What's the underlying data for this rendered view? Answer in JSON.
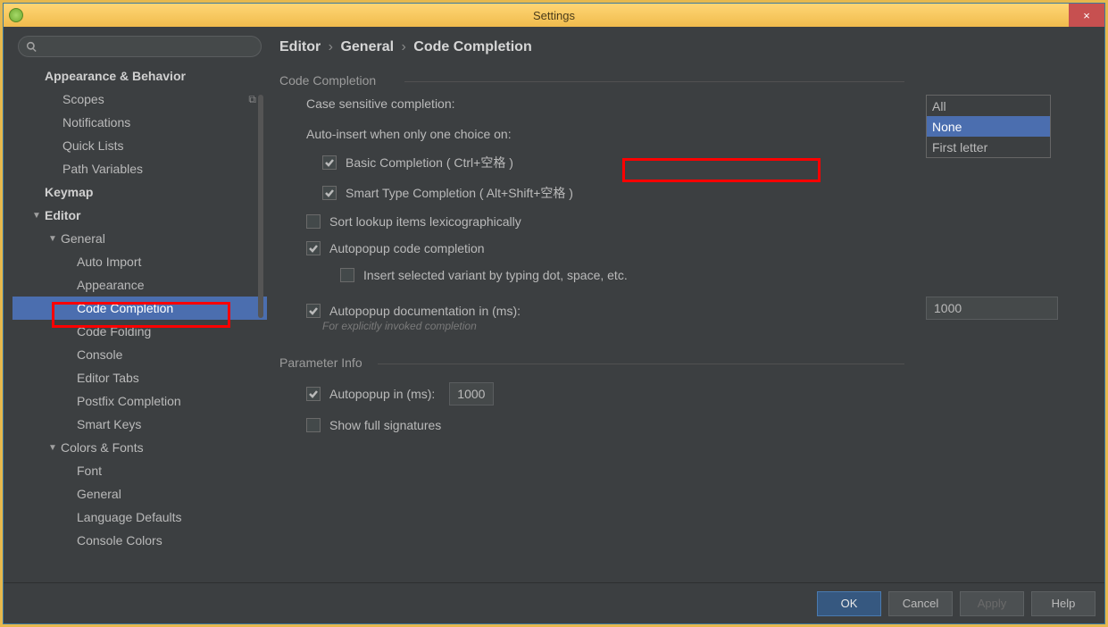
{
  "titlebar": {
    "title": "Settings",
    "close": "×"
  },
  "tree": {
    "items": [
      {
        "label": "Appearance & Behavior",
        "cat": true,
        "pad": "pad0"
      },
      {
        "label": "Scopes",
        "pad": "pad1",
        "copy": true
      },
      {
        "label": "Notifications",
        "pad": "pad1"
      },
      {
        "label": "Quick Lists",
        "pad": "pad1"
      },
      {
        "label": "Path Variables",
        "pad": "pad1"
      },
      {
        "label": "Keymap",
        "cat": true,
        "pad": "pad0"
      },
      {
        "label": "Editor",
        "cat": true,
        "arrow": "▼",
        "pad": "arrow-pad0"
      },
      {
        "label": "General",
        "arrow": "▼",
        "pad": "arrow-pad1"
      },
      {
        "label": "Auto Import",
        "pad": "pad2"
      },
      {
        "label": "Appearance",
        "pad": "pad2"
      },
      {
        "label": "Code Completion",
        "pad": "pad2",
        "sel": true
      },
      {
        "label": "Code Folding",
        "pad": "pad2"
      },
      {
        "label": "Console",
        "pad": "pad2"
      },
      {
        "label": "Editor Tabs",
        "pad": "pad2"
      },
      {
        "label": "Postfix Completion",
        "pad": "pad2"
      },
      {
        "label": "Smart Keys",
        "pad": "pad2"
      },
      {
        "label": "Colors & Fonts",
        "arrow": "▼",
        "pad": "arrow-pad1"
      },
      {
        "label": "Font",
        "pad": "pad2"
      },
      {
        "label": "General",
        "pad": "pad2"
      },
      {
        "label": "Language Defaults",
        "pad": "pad2"
      },
      {
        "label": "Console Colors",
        "pad": "pad2"
      }
    ]
  },
  "breadcrumb": {
    "a": "Editor",
    "b": "General",
    "c": "Code Completion",
    "sep": "›"
  },
  "sections": {
    "code_completion": "Code Completion",
    "parameter_info": "Parameter Info"
  },
  "form": {
    "case_label": "Case sensitive completion:",
    "case_value": "None",
    "auto_insert_label": "Auto-insert when only one choice on:",
    "basic": "Basic Completion ( Ctrl+空格 )",
    "smart": "Smart Type Completion ( Alt+Shift+空格 )",
    "sort": "Sort lookup items lexicographically",
    "autopopup_cc": "Autopopup code completion",
    "insert_variant": "Insert selected variant by typing dot, space, etc.",
    "autopopup_doc": "Autopopup documentation in (ms):",
    "doc_hint": "For explicitly invoked completion",
    "doc_value": "1000",
    "pi_autopopup": "Autopopup in (ms):",
    "pi_value": "1000",
    "pi_full": "Show full signatures"
  },
  "dropdown": {
    "items": [
      "All",
      "None",
      "First letter"
    ],
    "selected_index": 1
  },
  "footer": {
    "ok": "OK",
    "cancel": "Cancel",
    "apply": "Apply",
    "help": "Help"
  }
}
